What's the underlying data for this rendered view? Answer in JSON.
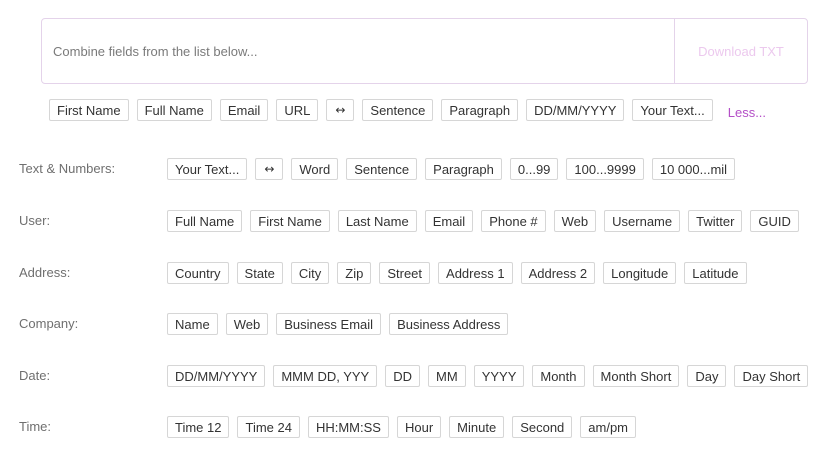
{
  "combine": {
    "placeholder": "Combine fields from the list below...",
    "download_label": "Download TXT"
  },
  "quick": {
    "chips": [
      "First Name",
      "Full Name",
      "Email",
      "URL",
      "↔",
      "Sentence",
      "Paragraph",
      "DD/MM/YYYY",
      "Your Text..."
    ],
    "less_label": "Less..."
  },
  "groups": [
    {
      "label": "Text & Numbers:",
      "chips": [
        "Your Text...",
        "↔",
        "Word",
        "Sentence",
        "Paragraph",
        "0...99",
        "100...9999",
        "10 000...mil"
      ]
    },
    {
      "label": "User:",
      "chips": [
        "Full Name",
        "First Name",
        "Last Name",
        "Email",
        "Phone #",
        "Web",
        "Username",
        "Twitter",
        "GUID"
      ]
    },
    {
      "label": "Address:",
      "chips": [
        "Country",
        "State",
        "City",
        "Zip",
        "Street",
        "Address 1",
        "Address 2",
        "Longitude",
        "Latitude"
      ]
    },
    {
      "label": "Company:",
      "chips": [
        "Name",
        "Web",
        "Business Email",
        "Business Address"
      ]
    },
    {
      "label": "Date:",
      "chips": [
        "DD/MM/YYYY",
        "MMM DD, YYY",
        "DD",
        "MM",
        "YYYY",
        "Month",
        "Month Short",
        "Day",
        "Day Short"
      ]
    },
    {
      "label": "Time:",
      "chips": [
        "Time 12",
        "Time 24",
        "HH:MM:SS",
        "Hour",
        "Minute",
        "Second",
        "am/pm"
      ]
    }
  ],
  "colors": {
    "accent": "#b44fc7",
    "download_disabled": "#ecc9ee",
    "box_border": "#e4d3ea",
    "chip_border": "#d6d6d6"
  }
}
